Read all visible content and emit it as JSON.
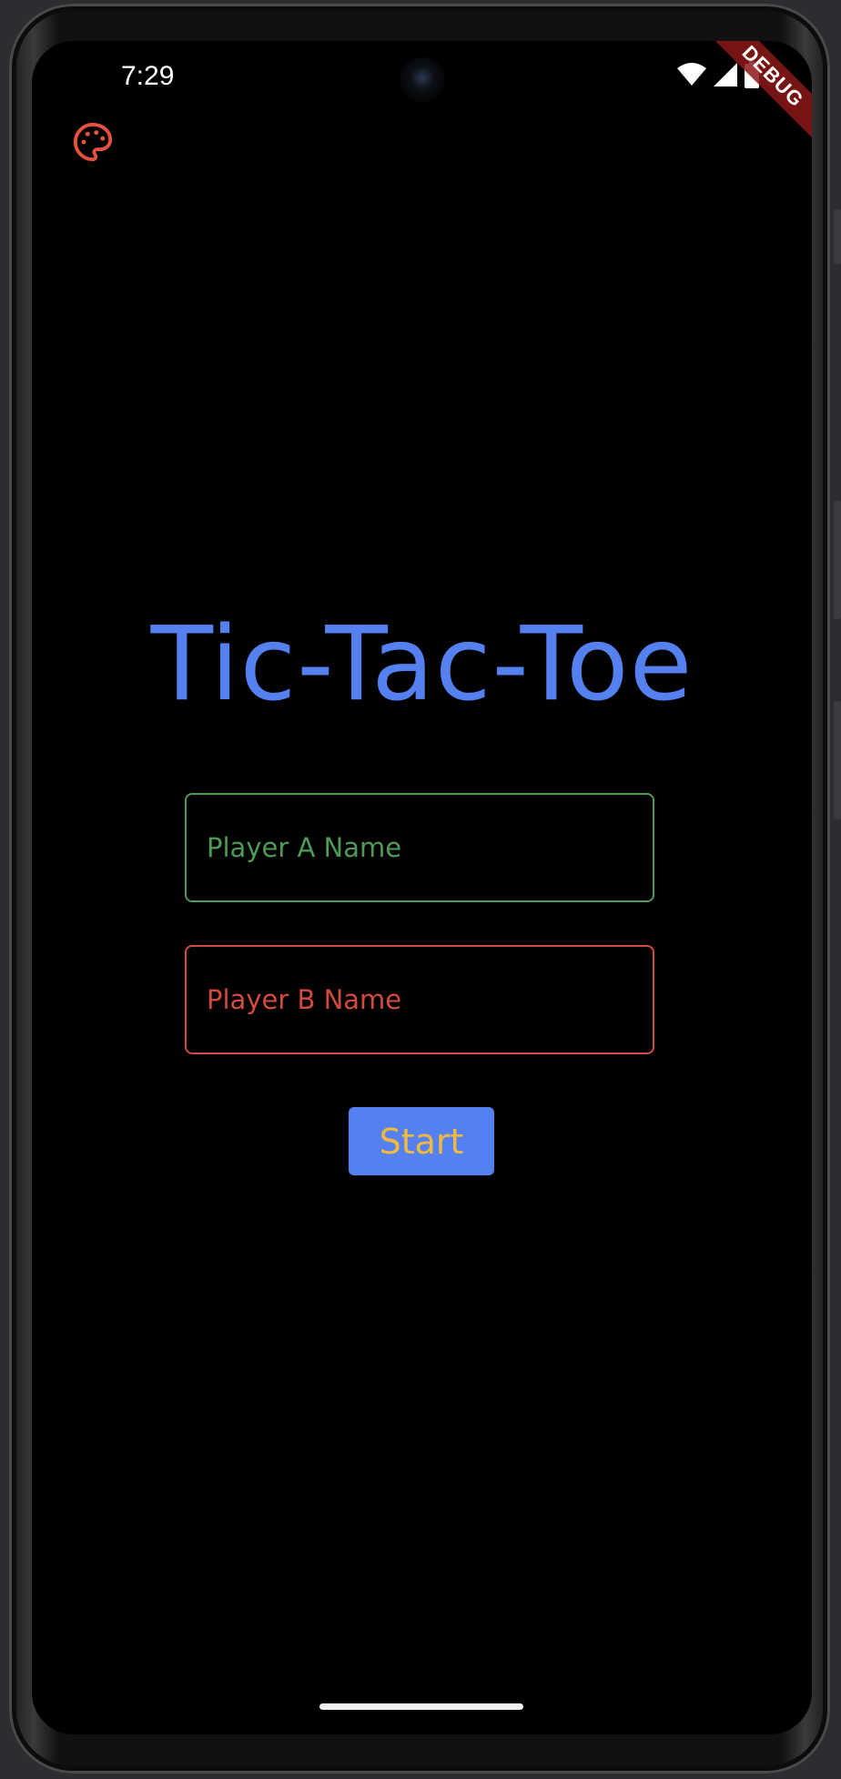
{
  "status_bar": {
    "time": "7:29",
    "icons": [
      "wifi-icon",
      "cellular-signal-icon",
      "battery-icon"
    ]
  },
  "debug_banner": {
    "label": "DEBUG"
  },
  "toolbar": {
    "theme_icon": "palette-icon"
  },
  "main": {
    "title": "Tic-Tac-Toe",
    "player_a": {
      "placeholder": "Player A Name",
      "value": ""
    },
    "player_b": {
      "placeholder": "Player B Name",
      "value": ""
    },
    "start_label": "Start"
  },
  "colors": {
    "background": "#000000",
    "title": "#5580ef",
    "player_a_accent": "#4e9a57",
    "player_b_accent": "#d34a3f",
    "button_bg": "#5580ef",
    "button_text": "#f1b93f",
    "palette_icon": "#e8503f"
  }
}
